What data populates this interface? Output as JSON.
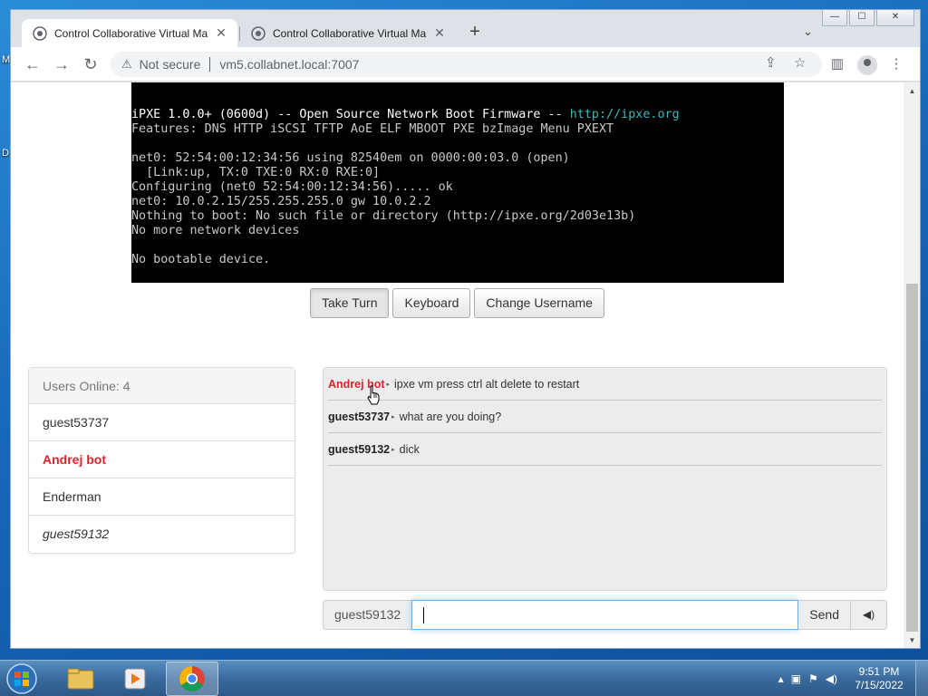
{
  "desktop": {
    "edge_label_1": "M",
    "edge_label_2": "D"
  },
  "browser": {
    "window_controls": {
      "minimize": "—",
      "maximize": "☐",
      "close": "✕"
    },
    "tabs": [
      {
        "label": "Control Collaborative Virtual Ma",
        "close": "✕",
        "active": true
      },
      {
        "label": "Control Collaborative Virtual Ma",
        "close": "✕",
        "active": false
      }
    ],
    "new_tab": "+",
    "tab_search": "⌄",
    "nav": {
      "back": "←",
      "forward": "→",
      "reload": "↻"
    },
    "address": {
      "security_label": "Not secure",
      "url": "vm5.collabnet.local:7007"
    }
  },
  "vm_screen": {
    "lines": [
      {
        "a": "iPXE 1.0.0+ (0600d) -- Open Source Network Boot Firmware -- ",
        "b": "http://ipxe.org"
      },
      {
        "a": "Features: DNS HTTP iSCSI TFTP AoE ELF MBOOT PXE bzImage Menu PXEXT"
      },
      {
        "a": ""
      },
      {
        "a": "net0: 52:54:00:12:34:56 using 82540em on 0000:00:03.0 (open)"
      },
      {
        "a": "  [Link:up, TX:0 TXE:0 RX:0 RXE:0]"
      },
      {
        "a": "Configuring (net0 52:54:00:12:34:56)..... ok"
      },
      {
        "a": "net0: 10.0.2.15/255.255.255.0 gw 10.0.2.2"
      },
      {
        "a": "Nothing to boot: No such file or directory (http://ipxe.org/2d03e13b)"
      },
      {
        "a": "No more network devices"
      },
      {
        "a": ""
      },
      {
        "a": "No bootable device."
      }
    ]
  },
  "vm_buttons": {
    "take_turn": "Take Turn",
    "keyboard": "Keyboard",
    "change_username": "Change Username"
  },
  "users": {
    "heading": "Users Online: 4",
    "list": [
      {
        "name": "guest53737",
        "role": "guest"
      },
      {
        "name": "Andrej bot",
        "role": "admin"
      },
      {
        "name": "Enderman",
        "role": "user"
      },
      {
        "name": "guest59132",
        "role": "self"
      }
    ]
  },
  "chat": {
    "messages": [
      {
        "user": "Andrej bot",
        "admin": true,
        "text": "ipxe vm press ctrl alt delete to restart"
      },
      {
        "user": "guest53737",
        "admin": false,
        "text": "what are you doing?"
      },
      {
        "user": "guest59132",
        "admin": false,
        "text": "dick"
      }
    ],
    "username": "guest59132",
    "input_value": "",
    "send_label": "Send",
    "sound_icon": "🔊"
  },
  "taskbar": {
    "clock_time": "9:51 PM",
    "clock_date": "7/15/2022"
  },
  "colors": {
    "admin_red": "#d9262e",
    "terminal_link": "#3fb8b8",
    "input_focus": "#66afe9"
  }
}
